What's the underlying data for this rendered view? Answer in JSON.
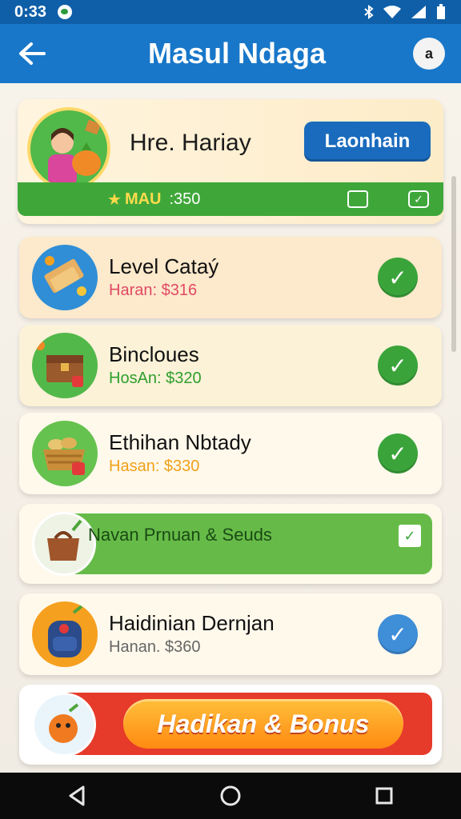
{
  "status_bar": {
    "time": "0:33"
  },
  "app_bar": {
    "title": "Masul Ndaga",
    "profile_badge": "a"
  },
  "header": {
    "name": "Hre. Hariay",
    "button_label": "Laonhain",
    "points_label": "MAU",
    "points_value": ":350"
  },
  "items": [
    {
      "title": "Level Cataý",
      "subtitle": "Haran: $316",
      "sub_color": "#e04a64",
      "bg": "#fde9cc",
      "icon_bg": "#2f8ed6"
    },
    {
      "title": "Bincloues",
      "subtitle": "HosAn: $320",
      "sub_color": "#2f9e2c",
      "bg": "#fbf2d8",
      "icon_bg": "#53b84a"
    },
    {
      "title": "Ethihan Nbtady",
      "subtitle": "Hasan: $330",
      "sub_color": "#f0a11a",
      "bg": "#fff9ec",
      "icon_bg": "#66c24e"
    }
  ],
  "promo": {
    "label": "Navan Prnuan & Seuds"
  },
  "item4": {
    "title": "Haidinian Dernjan",
    "subtitle": "Hanan. $360",
    "sub_color": "#666666",
    "bg": "#fff9ec"
  },
  "bonus": {
    "label": "Hadikan & Bonus"
  },
  "colors": {
    "app_bar": "#1877c9",
    "status_bar": "#0f5fa8",
    "accent_green": "#3fa73a",
    "accent_blue": "#1a6bbd",
    "bonus_red": "#e63a2a",
    "bonus_orange": "#ff8a12"
  }
}
